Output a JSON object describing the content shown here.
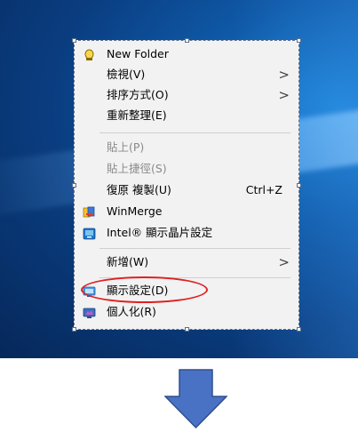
{
  "menu": {
    "items": [
      {
        "label": "New Folder",
        "icon": "folder-icon"
      },
      {
        "label": "檢視(V)",
        "submenu": true
      },
      {
        "label": "排序方式(O)",
        "submenu": true
      },
      {
        "label": "重新整理(E)"
      },
      {
        "label": "貼上(P)",
        "disabled": true
      },
      {
        "label": "貼上捷徑(S)",
        "disabled": true
      },
      {
        "label": "復原 複製(U)",
        "shortcut": "Ctrl+Z"
      },
      {
        "label": "WinMerge",
        "icon": "winmerge-icon"
      },
      {
        "label": "Intel® 顯示晶片設定",
        "icon": "intel-graphics-icon"
      },
      {
        "label": "新增(W)",
        "submenu": true
      },
      {
        "label": "顯示設定(D)",
        "icon": "display-settings-icon",
        "highlighted": true
      },
      {
        "label": "個人化(R)",
        "icon": "personalize-icon"
      }
    ],
    "submenu_arrow": ">"
  },
  "colors": {
    "highlight_circle": "#e02020",
    "down_arrow": "#4a72c4",
    "menu_background": "#f2f2f2"
  }
}
